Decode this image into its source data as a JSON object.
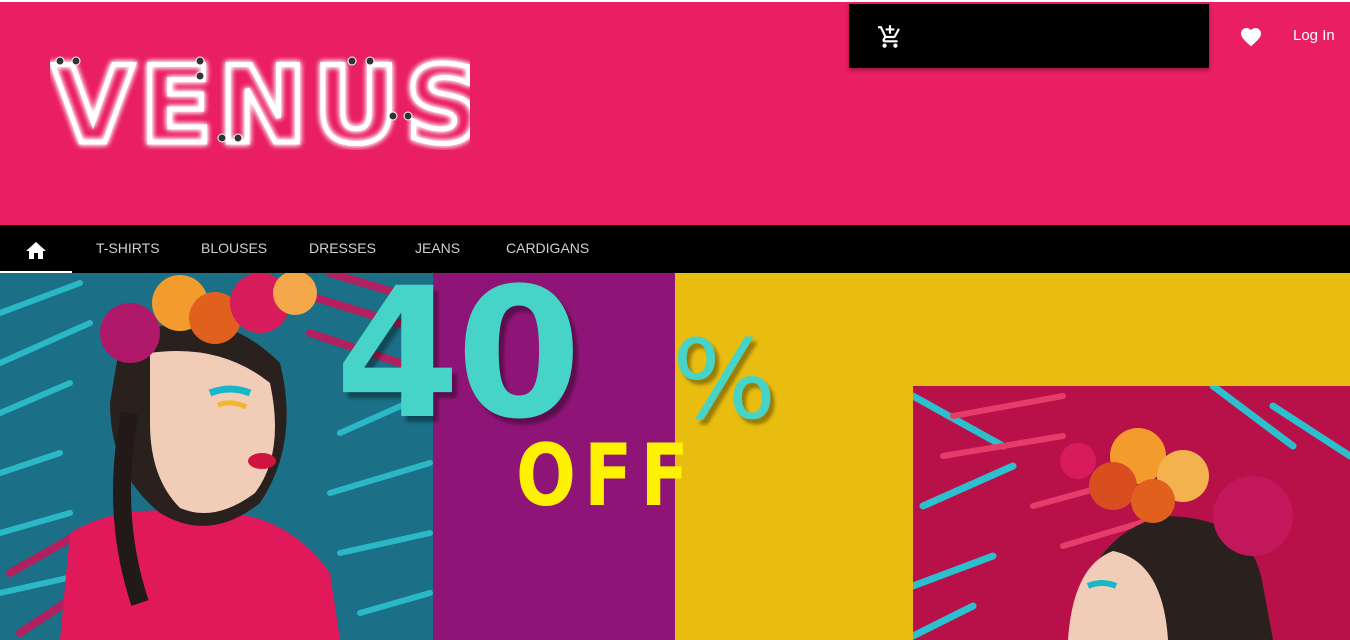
{
  "brand": {
    "logo_text": "VENUS"
  },
  "header": {
    "cart_icon": "add-shopping-cart-icon",
    "wishlist_icon": "heart-icon",
    "login_label": "Log In"
  },
  "nav": {
    "home_icon": "home-icon",
    "items": [
      {
        "label": "T-SHIRTS"
      },
      {
        "label": "BLOUSES"
      },
      {
        "label": "DRESSES"
      },
      {
        "label": "JEANS"
      },
      {
        "label": "CARDIGANS"
      }
    ]
  },
  "banner": {
    "discount": "40",
    "percent": "%",
    "off_text": "OFF"
  },
  "colors": {
    "brand_pink": "#e91e63",
    "nav_black": "#000000",
    "promo_teal": "#45d4c7",
    "promo_yellow": "#fff200",
    "banner_purple": "#8e1577",
    "banner_gold": "#e8bd0f"
  }
}
